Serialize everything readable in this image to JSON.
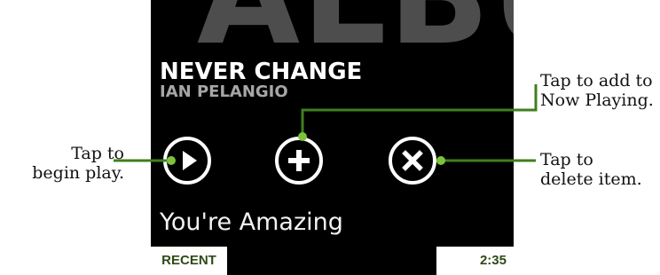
{
  "background_text": "ALBU",
  "song": {
    "title": "NEVER CHANGE",
    "artist": "IAN PELANGIO"
  },
  "controls": {
    "play": "play-icon",
    "add": "plus-icon",
    "delete": "x-icon"
  },
  "next_song": "You're Amazing",
  "bottom_bar": {
    "left_tab": "RECENT",
    "time": "2:35"
  },
  "callouts": {
    "play": {
      "line1": "Tap to",
      "line2": "begin play."
    },
    "add": {
      "line1": "Tap to add to",
      "line2": "Now Playing."
    },
    "delete": {
      "line1": "Tap to",
      "line2": "delete item."
    }
  },
  "colors": {
    "callout_line": "#3f7f1e",
    "callout_dot": "#7dc23a",
    "tab_text": "#2e4a16"
  }
}
